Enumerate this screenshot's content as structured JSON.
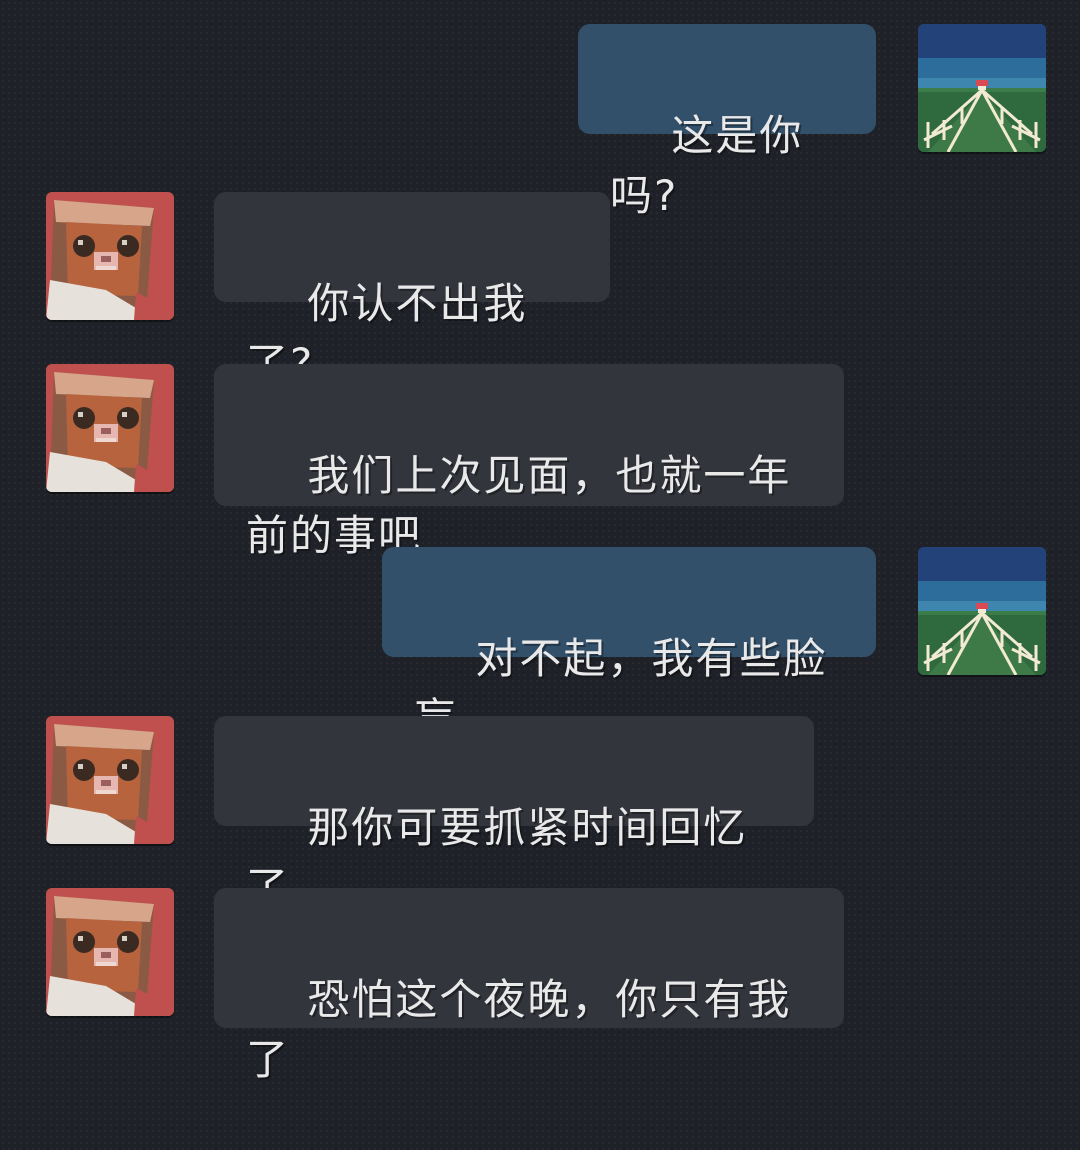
{
  "conversation": {
    "messages": [
      {
        "sender": "me",
        "text": "这是你吗?"
      },
      {
        "sender": "other",
        "text": "你认不出我了?"
      },
      {
        "sender": "other",
        "text": "我们上次见面，也就一年\n前的事吧"
      },
      {
        "sender": "me",
        "text": "对不起，我有些脸盲"
      },
      {
        "sender": "other",
        "text": "那你可要抓紧时间回忆了"
      },
      {
        "sender": "other",
        "text": "恐怕这个夜晚，你只有我\n了"
      }
    ]
  },
  "avatars": {
    "me_icon": "night-path-landscape-avatar",
    "other_icon": "pixel-animal-face-avatar"
  },
  "colors": {
    "background": "#1f2128",
    "bubble_other": "#33353d",
    "bubble_me": "#33506b",
    "text": "#e9e9ea",
    "avatar_other_frame": "#c0504d"
  }
}
